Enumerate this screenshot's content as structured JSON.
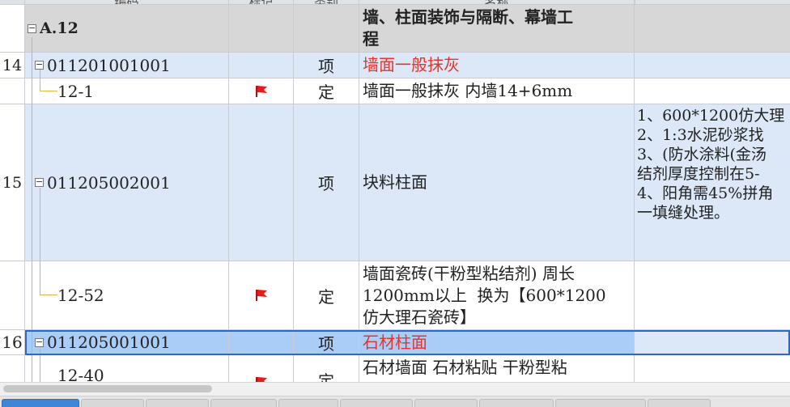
{
  "header": {
    "col_code": "编码",
    "col_mark": "标记",
    "col_category": "类别",
    "col_name": "名称"
  },
  "section": {
    "code": "A.12",
    "name_line1": "墙、柱面装饰与隔断、幕墙工",
    "name_line2": "程"
  },
  "rows": [
    {
      "num": "14",
      "code": "011201001001",
      "category": "项",
      "name": "墙面一般抹灰"
    },
    {
      "num": "",
      "code": "12-1",
      "category": "定",
      "name": "墙面一般抹灰 内墙14+6mm"
    },
    {
      "num": "15",
      "code": "011205002001",
      "category": "项",
      "name": "块料柱面",
      "features": [
        "1、600*1200仿大理",
        "2、1:3水泥砂浆找",
        "3、(防水涂料(金汤",
        "结剂厚度控制在5-",
        "4、阳角需45%拼角",
        "一填缝处理。"
      ]
    },
    {
      "num": "",
      "code": "12-52",
      "category": "定",
      "name_lines": [
        "墙面瓷砖(干粉型粘结剂) 周长",
        "1200mm以上  换为【600*1200",
        "仿大理石瓷砖】"
      ]
    },
    {
      "num": "16",
      "code": "011205001001",
      "category": "项",
      "name": "石材柱面"
    },
    {
      "num": "",
      "code": "12-40",
      "category": "定",
      "name": "石材墙面 石材粘贴 干粉型粘"
    }
  ],
  "colors": {
    "accent": "#2f67c9",
    "red_text": "#e8322a",
    "flag": "#e41b1b",
    "tree_line": "#e0b24a"
  },
  "icons": {
    "expand": "minus-box-icon",
    "flag": "red-flag-icon"
  }
}
